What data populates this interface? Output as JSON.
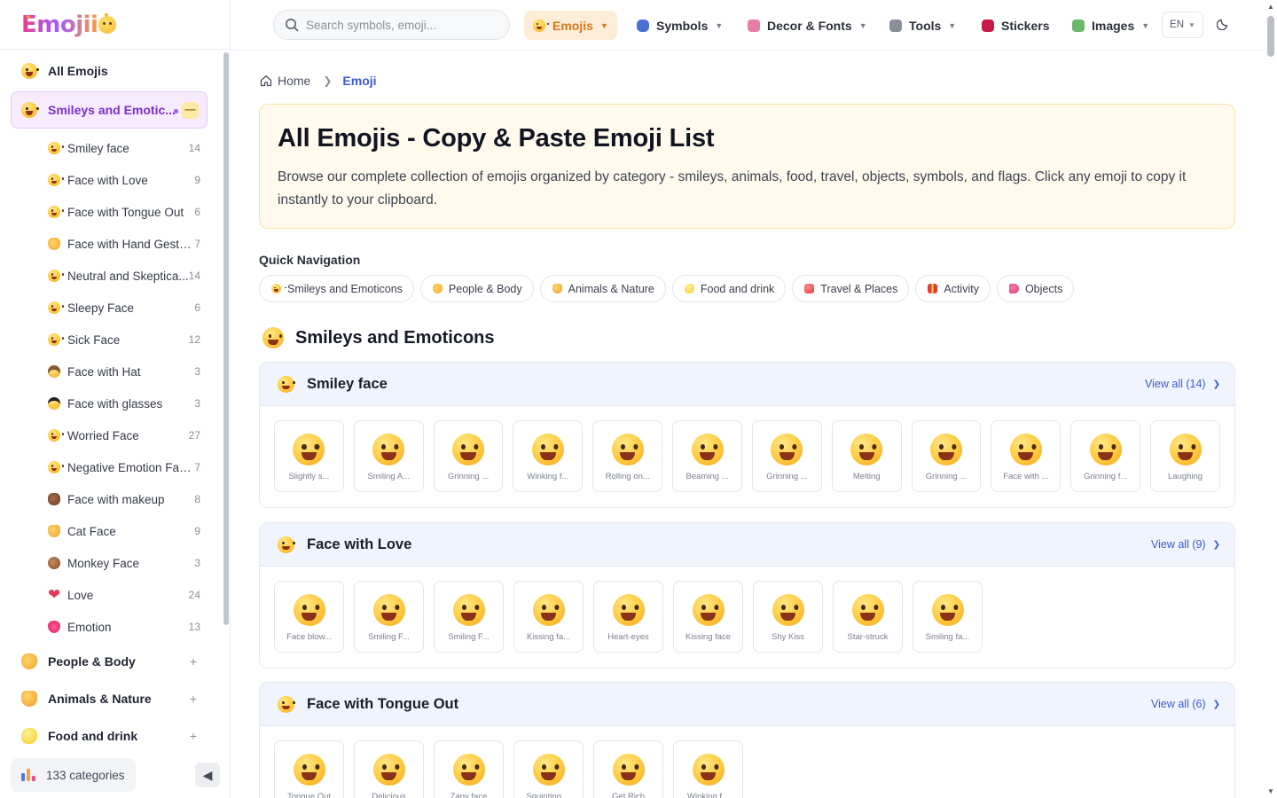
{
  "brand": {
    "logo_text": "Emojii"
  },
  "sidebar": {
    "all_label": "All Emojis",
    "active_label": "Smileys and Emotic...",
    "active_collapse": "—",
    "subitems": [
      {
        "label": "Smiley face",
        "count": "14",
        "icon": "face"
      },
      {
        "label": "Face with Love",
        "count": "9",
        "icon": "heart-eyes"
      },
      {
        "label": "Face with Tongue Out",
        "count": "6",
        "icon": "face"
      },
      {
        "label": "Face with Hand Gesture",
        "count": "7",
        "icon": "hand"
      },
      {
        "label": "Neutral and Skeptica...",
        "count": "14",
        "icon": "face"
      },
      {
        "label": "Sleepy Face",
        "count": "6",
        "icon": "face"
      },
      {
        "label": "Sick Face",
        "count": "12",
        "icon": "face"
      },
      {
        "label": "Face with Hat",
        "count": "3",
        "icon": "hat"
      },
      {
        "label": "Face with glasses",
        "count": "3",
        "icon": "glasses"
      },
      {
        "label": "Worried Face",
        "count": "27",
        "icon": "face"
      },
      {
        "label": "Negative Emotion Face",
        "count": "7",
        "icon": "face"
      },
      {
        "label": "Face with makeup",
        "count": "8",
        "icon": "poo"
      },
      {
        "label": "Cat Face",
        "count": "9",
        "icon": "cat"
      },
      {
        "label": "Monkey Face",
        "count": "3",
        "icon": "monkey"
      },
      {
        "label": "Love",
        "count": "24",
        "icon": "heart"
      },
      {
        "label": "Emotion",
        "count": "13",
        "icon": "lips"
      }
    ],
    "groups": [
      {
        "label": "People & Body",
        "icon": "hand"
      },
      {
        "label": "Animals & Nature",
        "icon": "cat"
      },
      {
        "label": "Food and drink",
        "icon": "lemon"
      }
    ],
    "footer": {
      "categories_label": "133 categories",
      "toggle": "◀"
    }
  },
  "topbar": {
    "search_placeholder": "Search symbols, emoji...",
    "nav": [
      {
        "label": "Emojis",
        "active": true,
        "dropdown": true,
        "icon": "smiley-icon"
      },
      {
        "label": "Symbols",
        "active": false,
        "dropdown": true,
        "icon": "infinity-icon"
      },
      {
        "label": "Decor & Fonts",
        "active": false,
        "dropdown": true,
        "icon": "palette-icon"
      },
      {
        "label": "Tools",
        "active": false,
        "dropdown": true,
        "icon": "tools-icon"
      },
      {
        "label": "Stickers",
        "active": false,
        "dropdown": false,
        "icon": "ribbon-icon"
      },
      {
        "label": "Images",
        "active": false,
        "dropdown": true,
        "icon": "picture-icon"
      }
    ],
    "language": "EN"
  },
  "breadcrumb": {
    "home": "Home",
    "current": "Emoji"
  },
  "hero": {
    "title": "All Emojis - Copy & Paste Emoji List",
    "description": "Browse our complete collection of emojis organized by category - smileys, animals, food, travel, objects, symbols, and flags. Click any emoji to copy it instantly to your clipboard."
  },
  "quick_nav": {
    "title": "Quick Navigation",
    "chips": [
      "Smileys and Emoticons",
      "People & Body",
      "Animals & Nature",
      "Food and drink",
      "Travel & Places",
      "Activity",
      "Objects"
    ]
  },
  "section": {
    "title": "Smileys and Emoticons"
  },
  "categories": [
    {
      "title": "Smiley face",
      "view_all": "View all (14)",
      "emojis": [
        "Slightly s...",
        "Smiling A...",
        "Grinning ...",
        "Winking f...",
        "Rolling on...",
        "Beaming ...",
        "Grinning ...",
        "Melting",
        "Grinning ...",
        "Face with ...",
        "Grinning f...",
        "Laughing"
      ]
    },
    {
      "title": "Face with Love",
      "view_all": "View all (9)",
      "emojis": [
        "Face blow...",
        "Smiling F...",
        "Smiling F...",
        "Kissing fa...",
        "Heart-eyes",
        "Kissing face",
        "Shy Kiss",
        "Star-struck",
        "Smiling fa..."
      ]
    },
    {
      "title": "Face with Tongue Out",
      "view_all": "View all (6)",
      "emojis": [
        "Tongue Out",
        "Delicious",
        "Zany face",
        "Squinting ...",
        "Get Rich",
        "Winking f..."
      ]
    }
  ]
}
